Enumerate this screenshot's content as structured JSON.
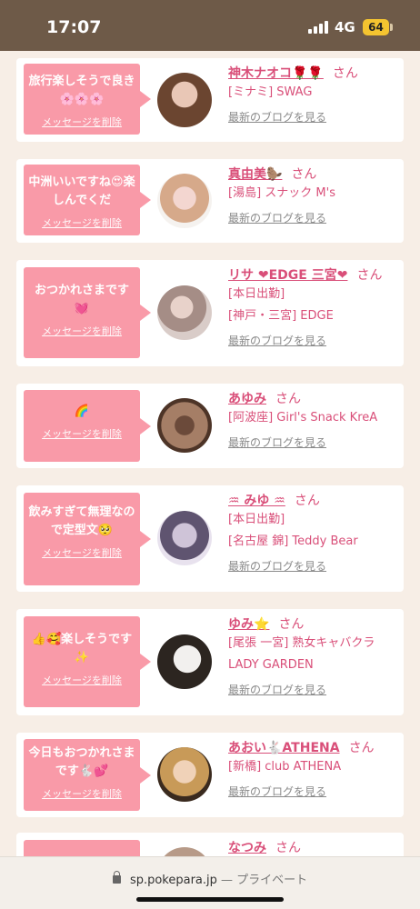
{
  "status_bar": {
    "time": "17:07",
    "network": "4G",
    "battery": "64"
  },
  "delete_label": "メッセージを削除",
  "blog_label": "最新のブログを見る",
  "honorific": "さん",
  "items": [
    {
      "message": "旅行楽しそうで良き🌸🌸🌸",
      "name": "神木ナオコ🌹🌹",
      "shop": "[ミナミ] SWAG",
      "extra": ""
    },
    {
      "message": "中洲いいですね😍楽しんでくだ",
      "name": "真由美🦫",
      "shop": "[湯島] スナック M's",
      "extra": ""
    },
    {
      "message": "おつかれさまです💓",
      "name": "リサ ❤EDGE 三宮❤",
      "shop": "[本日出勤]",
      "extra": "[神戸・三宮] EDGE"
    },
    {
      "message": "🌈",
      "name": "あゆみ",
      "shop": "[阿波座] Girl's Snack KreA",
      "extra": ""
    },
    {
      "message": "飲みすぎて無理なので定型文🥺",
      "name": "♒ みゆ ♒",
      "shop": "[本日出勤]",
      "extra": "[名古屋 錦] Teddy Bear"
    },
    {
      "message": "👍🥰楽しそうです✨",
      "name": "ゆみ⭐",
      "shop": "[尾張 一宮] 熟女キャバクラ LADY GARDEN",
      "extra": ""
    },
    {
      "message": "今日もおつかれさまです🐇💕",
      "name": "あおい🐇ATHENA",
      "shop": "[新橋] club ATHENA",
      "extra": ""
    },
    {
      "message": "",
      "name": "なつみ",
      "shop": "",
      "extra": ""
    }
  ],
  "bottom_bar": {
    "domain": "sp.pokepara.jp",
    "separator": "—",
    "mode": "プライベート"
  }
}
